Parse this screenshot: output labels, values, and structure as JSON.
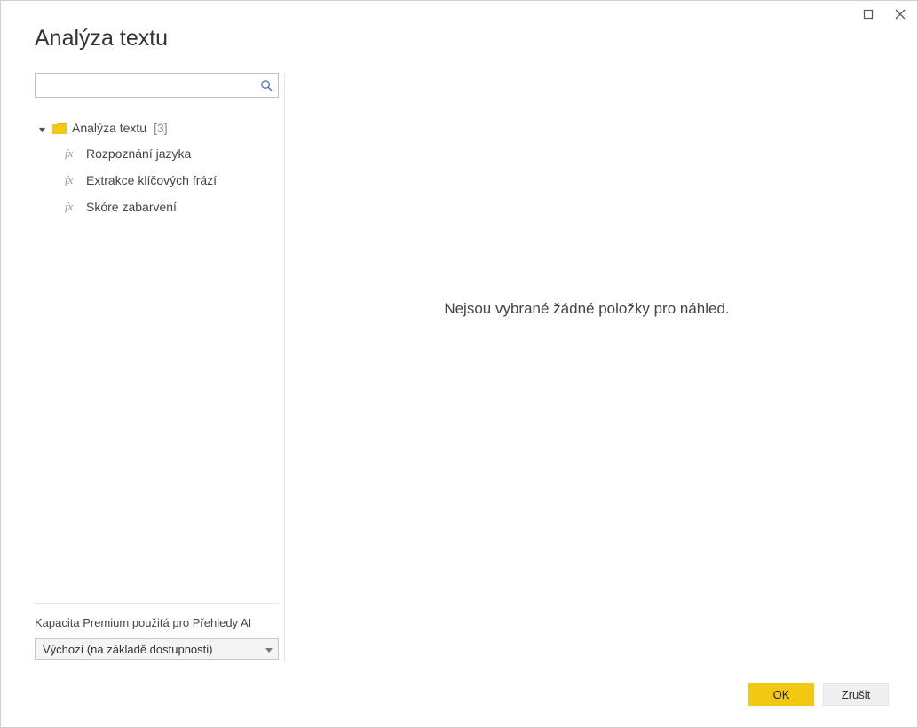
{
  "window": {
    "restore_label": "Restore",
    "close_label": "Close"
  },
  "dialog": {
    "title": "Analýza textu"
  },
  "search": {
    "value": "",
    "placeholder": ""
  },
  "tree": {
    "folder_label": "Analýza textu",
    "folder_count": "[3]",
    "items": [
      {
        "label": "Rozpoznání jazyka"
      },
      {
        "label": "Extrakce klíčových frází"
      },
      {
        "label": "Skóre zabarvení"
      }
    ]
  },
  "capacity": {
    "label": "Kapacita Premium použitá pro Přehledy AI",
    "selected": "Výchozí (na základě dostupnosti)"
  },
  "preview": {
    "empty_message": "Nejsou vybrané žádné položky pro náhled."
  },
  "footer": {
    "ok_label": "OK",
    "cancel_label": "Zrušit"
  }
}
